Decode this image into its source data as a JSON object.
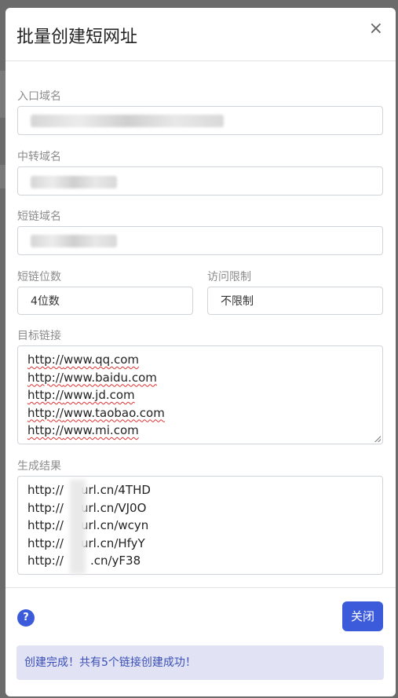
{
  "modal": {
    "title": "批量创建短网址",
    "close_icon": "×"
  },
  "form": {
    "entry_domain_label": "入口域名",
    "relay_domain_label": "中转域名",
    "short_domain_label": "短链域名",
    "short_length_label": "短链位数",
    "short_length_value": "4位数",
    "access_limit_label": "访问限制",
    "access_limit_value": "不限制",
    "target_links_label": "目标链接",
    "target_links": [
      {
        "scheme": "http://",
        "host": "www.qq.com"
      },
      {
        "scheme": "http://",
        "host": "www.baidu.com"
      },
      {
        "scheme": "http://",
        "host": "www.jd.com"
      },
      {
        "scheme": "http://",
        "host": "www.taobao.com"
      },
      {
        "scheme": "http://",
        "host": "www.mi.com"
      }
    ],
    "result_label": "生成结果",
    "results": [
      {
        "prefix": "http://",
        "suffix": "url.cn/4THD"
      },
      {
        "prefix": "http://",
        "suffix": "url.cn/VJ0O"
      },
      {
        "prefix": "http://",
        "suffix": "url.cn/wcyn"
      },
      {
        "prefix": "http://",
        "suffix": "url.cn/HfyY"
      },
      {
        "prefix": "http://",
        "suffix": ".cn/yF38"
      }
    ]
  },
  "footer": {
    "help_icon": "?",
    "close_button": "关闭",
    "status_message": "创建完成！共有5个链接创建成功！"
  },
  "colors": {
    "primary": "#3b5bdb",
    "alert_bg": "#e1e3f5",
    "alert_text": "#3b4fb6",
    "spellcheck": "#e03030"
  }
}
